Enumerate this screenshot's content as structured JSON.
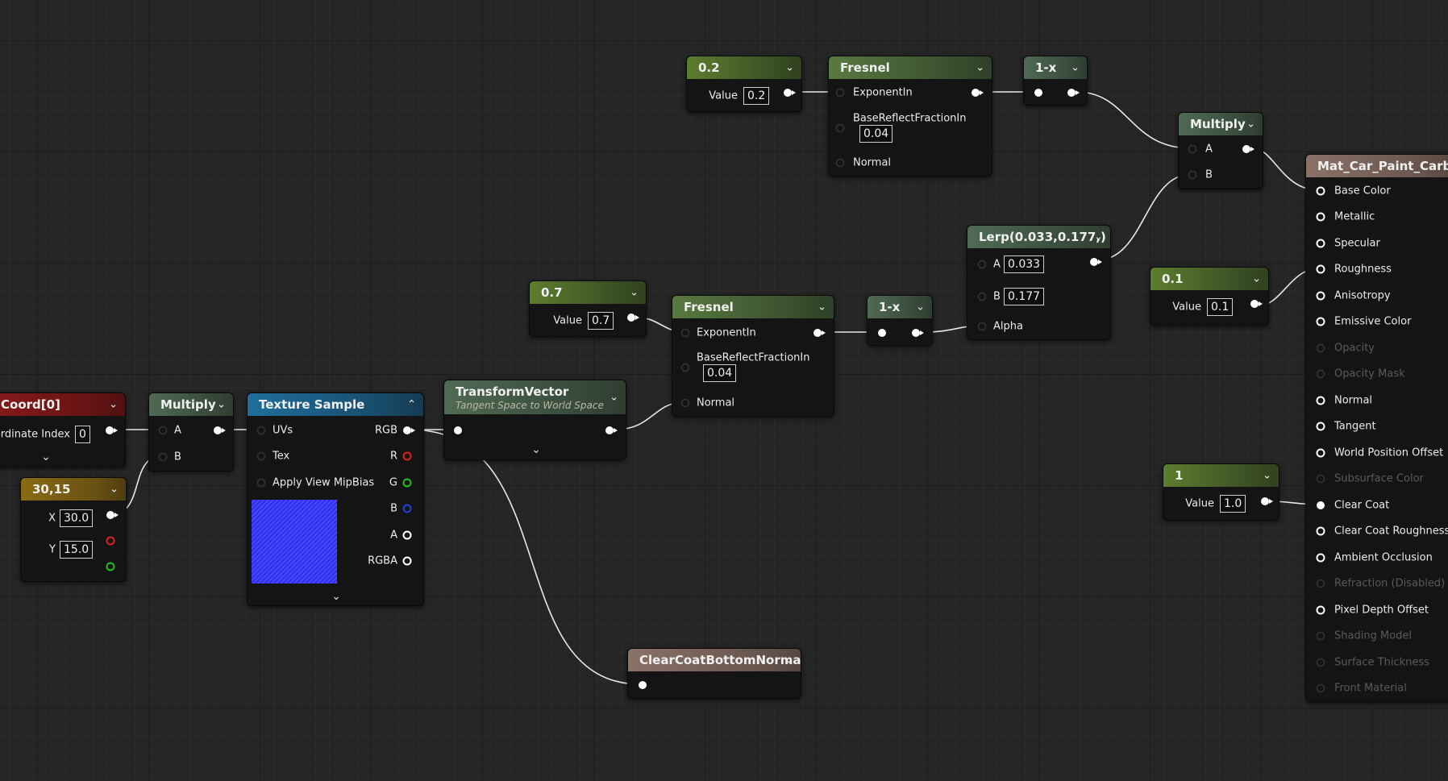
{
  "nodes": {
    "const_02": {
      "title": "0.2",
      "value_label": "Value",
      "value": "0.2"
    },
    "fresnel_top": {
      "title": "Fresnel",
      "pin_exponent": "ExponentIn",
      "pin_base": "BaseReflectFractionIn",
      "base_value": "0.04",
      "pin_normal": "Normal"
    },
    "oneminus_top": {
      "title": "1-x"
    },
    "multiply_top": {
      "title": "Multiply",
      "pin_a": "A",
      "pin_b": "B"
    },
    "material": {
      "title": "Mat_Car_Paint_Carbon_l",
      "pins": [
        "Base Color",
        "Metallic",
        "Specular",
        "Roughness",
        "Anisotropy",
        "Emissive Color",
        "Opacity",
        "Opacity Mask",
        "Normal",
        "Tangent",
        "World Position Offset",
        "Subsurface Color",
        "Clear Coat",
        "Clear Coat Roughness",
        "Ambient Occlusion",
        "Refraction (Disabled)",
        "Pixel Depth Offset",
        "Shading Model",
        "Surface Thickness",
        "Front Material"
      ]
    },
    "lerp": {
      "title": "Lerp(0.033,0.177,)",
      "pin_a": "A",
      "a_value": "0.033",
      "pin_b": "B",
      "b_value": "0.177",
      "pin_alpha": "Alpha"
    },
    "const_01": {
      "title": "0.1",
      "value_label": "Value",
      "value": "0.1"
    },
    "const_07": {
      "title": "0.7",
      "value_label": "Value",
      "value": "0.7"
    },
    "fresnel_mid": {
      "title": "Fresnel",
      "pin_exponent": "ExponentIn",
      "pin_base": "BaseReflectFractionIn",
      "base_value": "0.04",
      "pin_normal": "Normal"
    },
    "oneminus_mid": {
      "title": "1-x"
    },
    "texcoord": {
      "title": "Coord[0]",
      "index_label": "ordinate Index",
      "index_value": "0"
    },
    "multiply_left": {
      "title": "Multiply",
      "pin_a": "A",
      "pin_b": "B"
    },
    "texture_sample": {
      "title": "Texture Sample",
      "pin_uvs": "UVs",
      "pin_tex": "Tex",
      "pin_mip": "Apply View MipBias",
      "out_rgb": "RGB",
      "out_r": "R",
      "out_g": "G",
      "out_b": "B",
      "out_a": "A",
      "out_rgba": "RGBA"
    },
    "transform_vector": {
      "title": "TransformVector",
      "subtitle": "Tangent Space to World Space"
    },
    "const2": {
      "title": "30,15",
      "x_label": "X",
      "x_value": "30.0",
      "y_label": "Y",
      "y_value": "15.0"
    },
    "const_1": {
      "title": "1",
      "value_label": "Value",
      "value": "1.0"
    },
    "clearcoat_normal": {
      "title": "ClearCoatBottomNormal"
    }
  },
  "icons": {
    "collapse": "chevron-down-icon",
    "expand": "chevron-up-icon"
  },
  "colors": {
    "background": "#252525",
    "wire": "#ffffff",
    "pin_red": "#e02020",
    "pin_green": "#22c022",
    "pin_blue": "#2040e0",
    "texture_preview": "#3a3aff"
  }
}
